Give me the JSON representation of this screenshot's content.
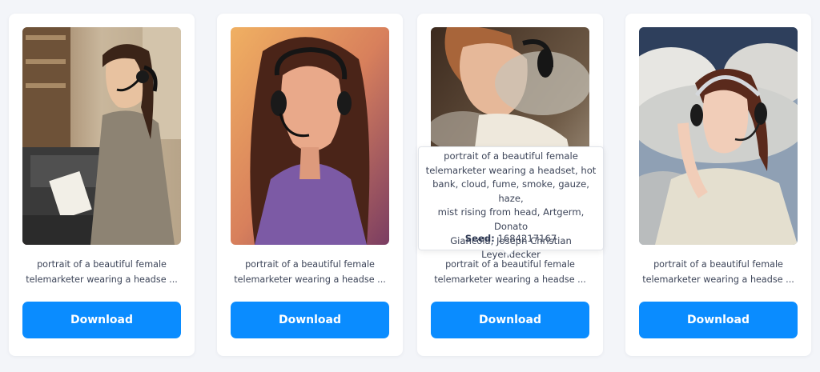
{
  "colors": {
    "accent": "#0a8cff",
    "background": "#f3f5f9"
  },
  "cards": [
    {
      "caption_line1": "portrait of a beautiful female",
      "caption_line2": "telemarketer wearing a headse ...",
      "download_label": "Download",
      "image": "woman-with-headset-at-office-machine"
    },
    {
      "caption_line1": "portrait of a beautiful female",
      "caption_line2": "telemarketer wearing a headse ...",
      "download_label": "Download",
      "image": "woman-with-headset-warm-painting"
    },
    {
      "caption_line1": "portrait of a beautiful female",
      "caption_line2": "telemarketer wearing a headse ...",
      "download_label": "Download",
      "image": "woman-with-headset-smoke"
    },
    {
      "caption_line1": "portrait of a beautiful female",
      "caption_line2": "telemarketer wearing a headse ...",
      "download_label": "Download",
      "image": "woman-with-headset-clouds"
    }
  ],
  "tooltip": {
    "prompt_lines": [
      "portrait of a beautiful female",
      "telemarketer wearing a headset, hot",
      "bank, cloud, fume, smoke, gauze, haze,",
      "mist rising from head, Artgerm, Donato",
      "Giancola, Joseph Christian Leyendecker"
    ],
    "seed_label": "Seed:",
    "seed_value": "1684217167"
  }
}
